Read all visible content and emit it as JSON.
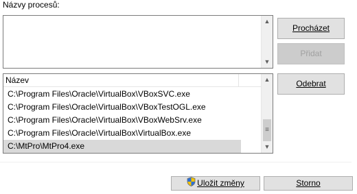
{
  "window": {
    "processes_label": "Názvy procesů:"
  },
  "input": {
    "value": ""
  },
  "buttons": {
    "browse": "Procházet",
    "add": "Přidat",
    "remove": "Odebrat",
    "save": "Uložit změny",
    "cancel": "Storno"
  },
  "list": {
    "column_header": "Název",
    "items": [
      "C:\\Program Files\\Oracle\\VirtualBox\\VBoxSVC.exe",
      "C:\\Program Files\\Oracle\\VirtualBox\\VBoxTestOGL.exe",
      "C:\\Program Files\\Oracle\\VirtualBox\\VBoxWebSrv.exe",
      "C:\\Program Files\\Oracle\\VirtualBox\\VirtualBox.exe",
      "C:\\MtPro\\MtPro4.exe"
    ],
    "selected_index": 4
  },
  "icons": {
    "save_button_icon": "uac-shield-icon",
    "scroll_up": "chevron-up-icon",
    "scroll_down": "chevron-down-icon",
    "thumb_grip": "grip-icon"
  }
}
